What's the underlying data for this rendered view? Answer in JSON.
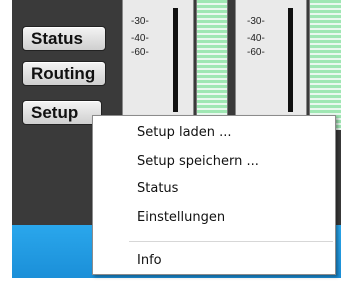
{
  "side_buttons": {
    "status": "Status",
    "routing": "Routing",
    "setup": "Setup"
  },
  "meters": [
    {
      "ticks": [
        "-30-",
        "-40-",
        "-60-"
      ]
    },
    {
      "ticks": [
        "-30-",
        "-40-",
        "-60-"
      ]
    }
  ],
  "context_menu": {
    "items": [
      "Setup laden ...",
      "Setup speichern ...",
      "Status",
      "Einstellungen",
      "Info"
    ]
  },
  "colors": {
    "panel": "#3a3a3a",
    "accent_blue": "#1b8fd8",
    "led_green": "#9fe7b3"
  }
}
